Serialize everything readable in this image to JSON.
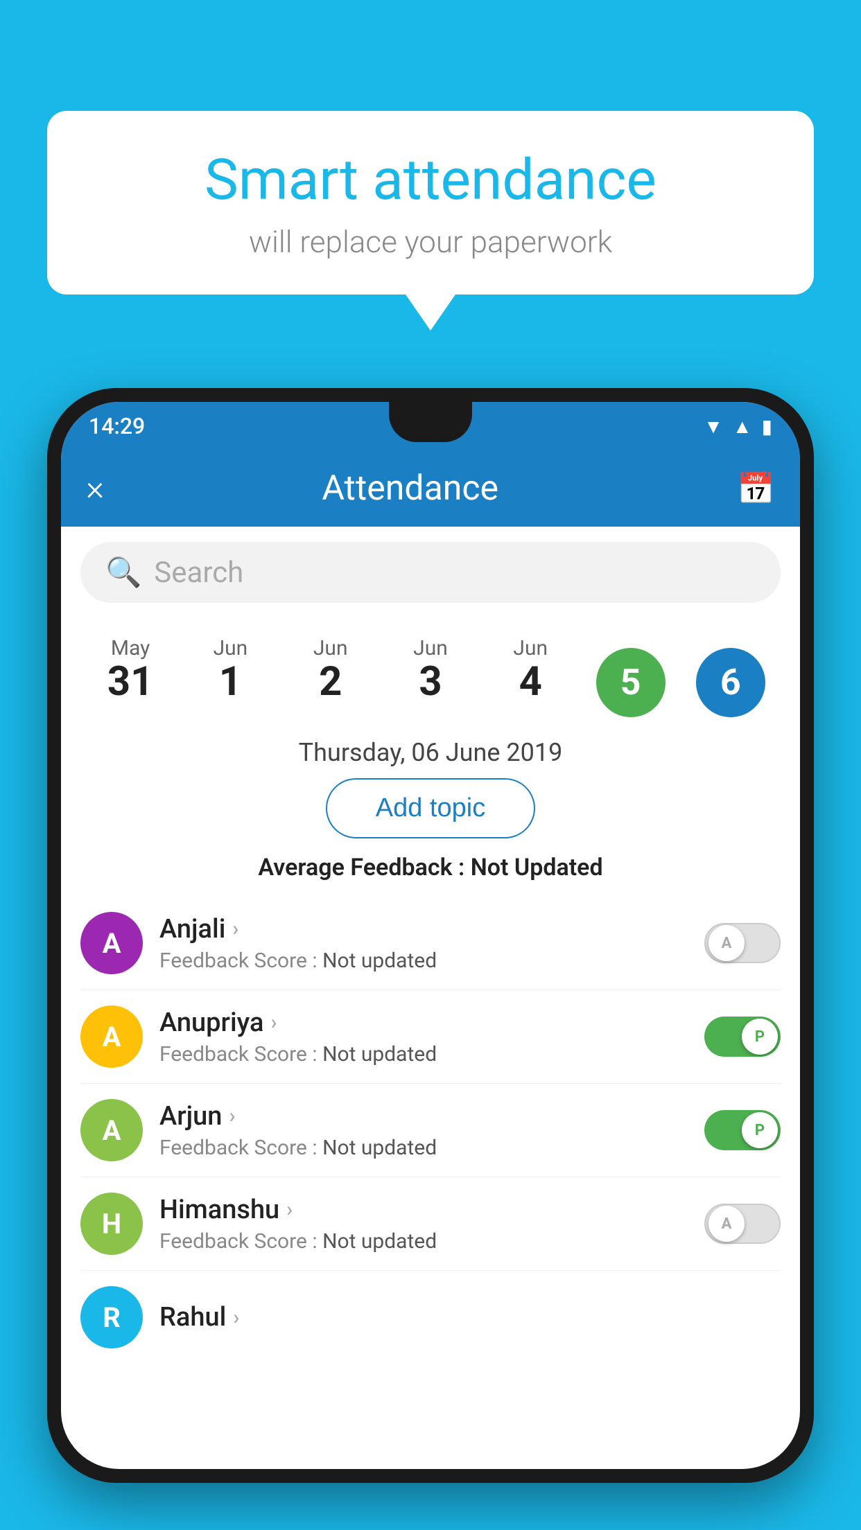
{
  "background_color": "#1ab8e8",
  "speech_bubble": {
    "title": "Smart attendance",
    "subtitle": "will replace your paperwork"
  },
  "status_bar": {
    "time": "14:29",
    "wifi_icon": "wifi",
    "signal_icon": "signal",
    "battery_icon": "battery"
  },
  "app_bar": {
    "title": "Attendance",
    "close_label": "×",
    "calendar_icon": "calendar"
  },
  "search": {
    "placeholder": "Search"
  },
  "calendar": {
    "dates": [
      {
        "month": "May",
        "day": "31",
        "state": "normal"
      },
      {
        "month": "Jun",
        "day": "1",
        "state": "normal"
      },
      {
        "month": "Jun",
        "day": "2",
        "state": "normal"
      },
      {
        "month": "Jun",
        "day": "3",
        "state": "normal"
      },
      {
        "month": "Jun",
        "day": "4",
        "state": "normal"
      },
      {
        "month": "Jun",
        "day": "5",
        "state": "today"
      },
      {
        "month": "Jun",
        "day": "6",
        "state": "selected"
      }
    ],
    "selected_date_label": "Thursday, 06 June 2019"
  },
  "add_topic_label": "Add topic",
  "avg_feedback_prefix": "Average Feedback : ",
  "avg_feedback_value": "Not Updated",
  "students": [
    {
      "name": "Anjali",
      "avatar_letter": "A",
      "avatar_color": "#9c27b0",
      "feedback_label": "Feedback Score : ",
      "feedback_value": "Not updated",
      "toggle_state": "off",
      "toggle_letter": "A"
    },
    {
      "name": "Anupriya",
      "avatar_letter": "A",
      "avatar_color": "#ffc107",
      "feedback_label": "Feedback Score : ",
      "feedback_value": "Not updated",
      "toggle_state": "on",
      "toggle_letter": "P"
    },
    {
      "name": "Arjun",
      "avatar_letter": "A",
      "avatar_color": "#8bc34a",
      "feedback_label": "Feedback Score : ",
      "feedback_value": "Not updated",
      "toggle_state": "on",
      "toggle_letter": "P"
    },
    {
      "name": "Himanshu",
      "avatar_letter": "H",
      "avatar_color": "#8bc34a",
      "feedback_label": "Feedback Score : ",
      "feedback_value": "Not updated",
      "toggle_state": "off",
      "toggle_letter": "A"
    }
  ],
  "partial_student": {
    "name": "Rahul",
    "avatar_letter": "R",
    "avatar_color": "#1ab8e8"
  }
}
